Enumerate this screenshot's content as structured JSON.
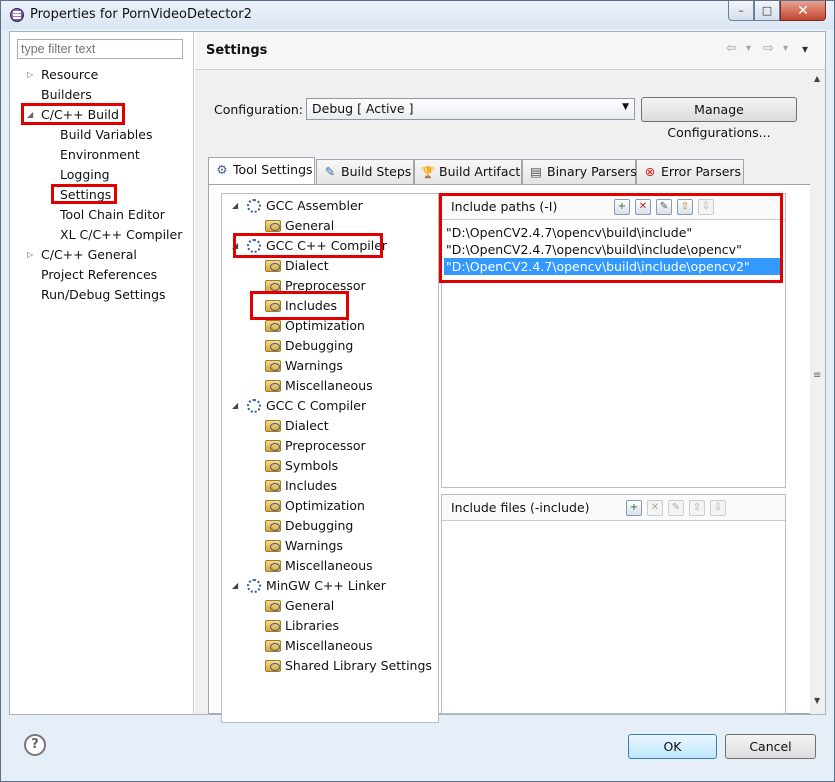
{
  "window": {
    "title": "Properties for PornVideoDetector2",
    "controls": {
      "minimize": "–",
      "maximize": "□",
      "close": "✕"
    }
  },
  "left": {
    "filter_placeholder": "type filter text",
    "items": [
      {
        "label": "Resource",
        "twisty": "▷"
      },
      {
        "label": "Builders"
      },
      {
        "label": "C/C++ Build",
        "twisty": "◢"
      },
      {
        "label": "Build Variables"
      },
      {
        "label": "Environment"
      },
      {
        "label": "Logging"
      },
      {
        "label": "Settings"
      },
      {
        "label": "Tool Chain Editor"
      },
      {
        "label": "XL C/C++ Compiler"
      },
      {
        "label": "C/C++ General",
        "twisty": "▷"
      },
      {
        "label": "Project References"
      },
      {
        "label": "Run/Debug Settings"
      }
    ]
  },
  "settings": {
    "title": "Settings",
    "nav": {
      "back": "⇦",
      "back_menu": "▾",
      "forward": "⇨",
      "forward_menu": "▾",
      "view_menu": "▾"
    },
    "configuration_label": "Configuration:",
    "configuration_value": "Debug  [ Active ]",
    "configuration_arrow": "▼",
    "manage_button": "Manage Configurations...",
    "tabs": [
      {
        "label": "Tool Settings",
        "icon": "⚙"
      },
      {
        "label": "Build Steps",
        "icon": "✎"
      },
      {
        "label": "Build Artifact",
        "icon": "🏆"
      },
      {
        "label": "Binary Parsers",
        "icon": "▤"
      },
      {
        "label": "Error Parsers",
        "icon": "⊗"
      }
    ]
  },
  "tool_tree": [
    {
      "label": "GCC Assembler",
      "level": 0,
      "expander": "◢"
    },
    {
      "label": "General",
      "level": 1
    },
    {
      "label": "GCC C++ Compiler",
      "level": 0,
      "expander": "◢"
    },
    {
      "label": "Dialect",
      "level": 1
    },
    {
      "label": "Preprocessor",
      "level": 1
    },
    {
      "label": "Includes",
      "level": 1
    },
    {
      "label": "Optimization",
      "level": 1
    },
    {
      "label": "Debugging",
      "level": 1
    },
    {
      "label": "Warnings",
      "level": 1
    },
    {
      "label": "Miscellaneous",
      "level": 1
    },
    {
      "label": "GCC C Compiler",
      "level": 0,
      "expander": "◢"
    },
    {
      "label": "Dialect",
      "level": 1
    },
    {
      "label": "Preprocessor",
      "level": 1
    },
    {
      "label": "Symbols",
      "level": 1
    },
    {
      "label": "Includes",
      "level": 1
    },
    {
      "label": "Optimization",
      "level": 1
    },
    {
      "label": "Debugging",
      "level": 1
    },
    {
      "label": "Warnings",
      "level": 1
    },
    {
      "label": "Miscellaneous",
      "level": 1
    },
    {
      "label": "MinGW C++ Linker",
      "level": 0,
      "expander": "◢"
    },
    {
      "label": "General",
      "level": 1
    },
    {
      "label": "Libraries",
      "level": 1
    },
    {
      "label": "Miscellaneous",
      "level": 1
    },
    {
      "label": "Shared Library Settings",
      "level": 1
    }
  ],
  "include_paths": {
    "title": "Include paths (-I)",
    "icons": [
      {
        "name": "add-icon",
        "glyph": "+"
      },
      {
        "name": "delete-icon",
        "glyph": "✕"
      },
      {
        "name": "edit-icon",
        "glyph": "✎"
      },
      {
        "name": "move-up-icon",
        "glyph": "⇧"
      },
      {
        "name": "move-down-icon",
        "glyph": "⇩"
      }
    ],
    "paths": [
      "\"D:\\OpenCV2.4.7\\opencv\\build\\include\"",
      "\"D:\\OpenCV2.4.7\\opencv\\build\\include\\opencv\"",
      "\"D:\\OpenCV2.4.7\\opencv\\build\\include\\opencv2\""
    ]
  },
  "include_files": {
    "title": "Include files (-include)",
    "icons": [
      {
        "name": "add-icon",
        "glyph": "+"
      },
      {
        "name": "delete-icon",
        "glyph": "✕"
      },
      {
        "name": "edit-icon",
        "glyph": "✎"
      },
      {
        "name": "move-up-icon",
        "glyph": "⇧"
      },
      {
        "name": "move-down-icon",
        "glyph": "⇩"
      }
    ]
  },
  "scrollbar": {
    "up": "▲",
    "down": "▼",
    "grip": "≡"
  },
  "buttons": {
    "help": "?",
    "ok": "OK",
    "cancel": "Cancel"
  },
  "colors": {
    "highlight": "#e00000",
    "selection": "#3399ff"
  }
}
